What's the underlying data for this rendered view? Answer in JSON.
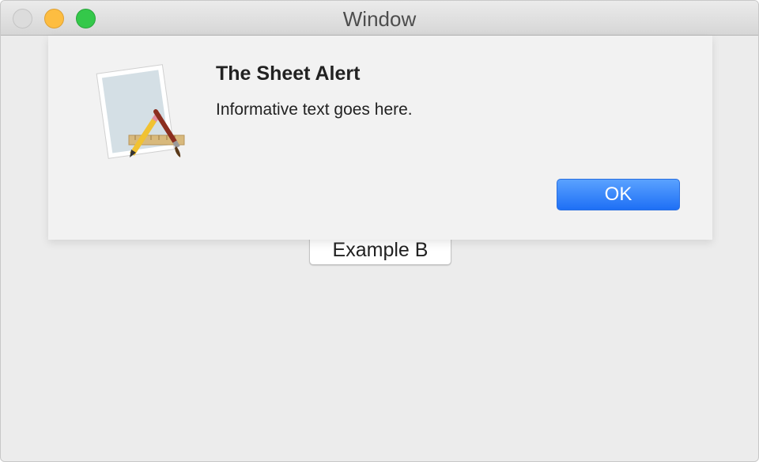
{
  "window": {
    "title": "Window"
  },
  "alert": {
    "icon": "text-edit-app-icon",
    "title": "The Sheet Alert",
    "informative_text": "Informative text goes here.",
    "ok_label": "OK"
  },
  "main": {
    "example_button_label": "Example B"
  },
  "colors": {
    "accent": "#1e6ff5",
    "close": "#dcdcdc",
    "minimize": "#fdbd41",
    "zoom": "#34c84a"
  }
}
